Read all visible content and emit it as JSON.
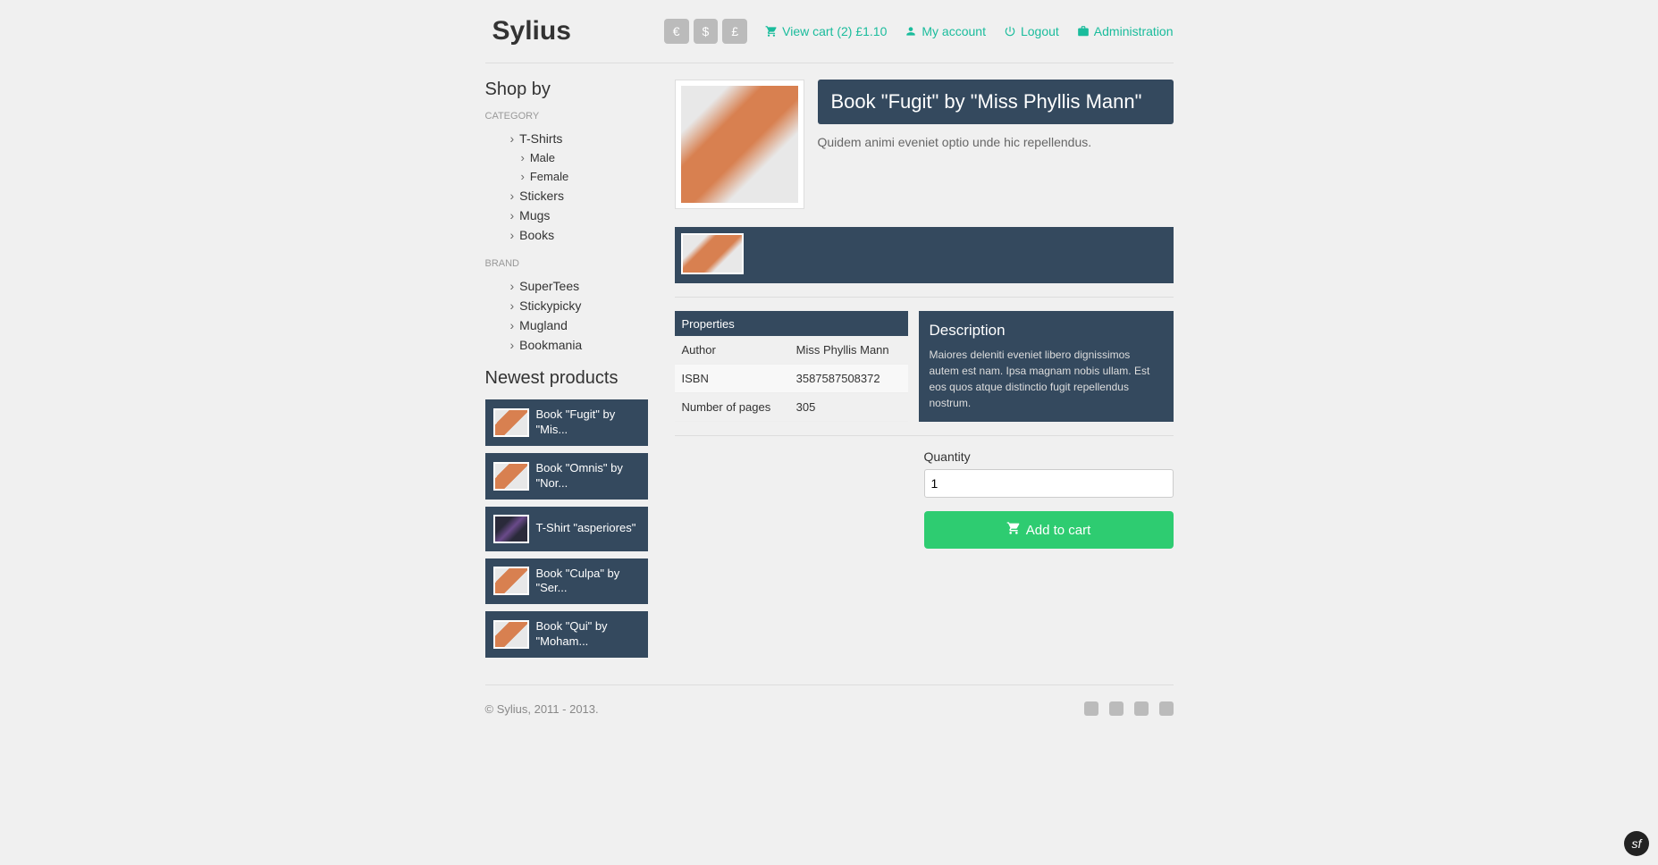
{
  "logo": "Sylius",
  "currencies": [
    "€",
    "$",
    "£"
  ],
  "header_links": {
    "cart": "View cart (2) £1.10",
    "account": "My account",
    "logout": "Logout",
    "admin": "Administration"
  },
  "sidebar": {
    "title": "Shop by",
    "category_label": "CATEGORY",
    "brand_label": "BRAND",
    "categories": [
      {
        "label": "T-Shirts",
        "sub": false
      },
      {
        "label": "Male",
        "sub": true
      },
      {
        "label": "Female",
        "sub": true
      },
      {
        "label": "Stickers",
        "sub": false
      },
      {
        "label": "Mugs",
        "sub": false
      },
      {
        "label": "Books",
        "sub": false
      }
    ],
    "brands": [
      {
        "label": "SuperTees"
      },
      {
        "label": "Stickypicky"
      },
      {
        "label": "Mugland"
      },
      {
        "label": "Bookmania"
      }
    ],
    "newest_title": "Newest products",
    "newest": [
      {
        "title": "Book \"Fugit\" by \"Mis..."
      },
      {
        "title": "Book \"Omnis\" by \"Nor..."
      },
      {
        "title": "T-Shirt \"asperiores\""
      },
      {
        "title": "Book \"Culpa\" by \"Ser..."
      },
      {
        "title": "Book \"Qui\" by \"Moham..."
      }
    ]
  },
  "product": {
    "title": "Book \"Fugit\" by \"Miss Phyllis Mann\"",
    "short_desc": "Quidem animi eveniet optio unde hic repellendus.",
    "properties_header": "Properties",
    "properties": [
      {
        "key": "Author",
        "value": "Miss Phyllis Mann"
      },
      {
        "key": "ISBN",
        "value": "3587587508372"
      },
      {
        "key": "Number of pages",
        "value": "305"
      }
    ],
    "description_header": "Description",
    "description": "Maiores deleniti eveniet libero dignissimos autem est nam. Ipsa magnam nobis ullam. Est eos quos atque distinctio fugit repellendus nostrum.",
    "quantity_label": "Quantity",
    "quantity_value": "1",
    "add_to_cart": "Add to cart"
  },
  "footer": {
    "copyright": "© Sylius, 2011 - 2013."
  }
}
